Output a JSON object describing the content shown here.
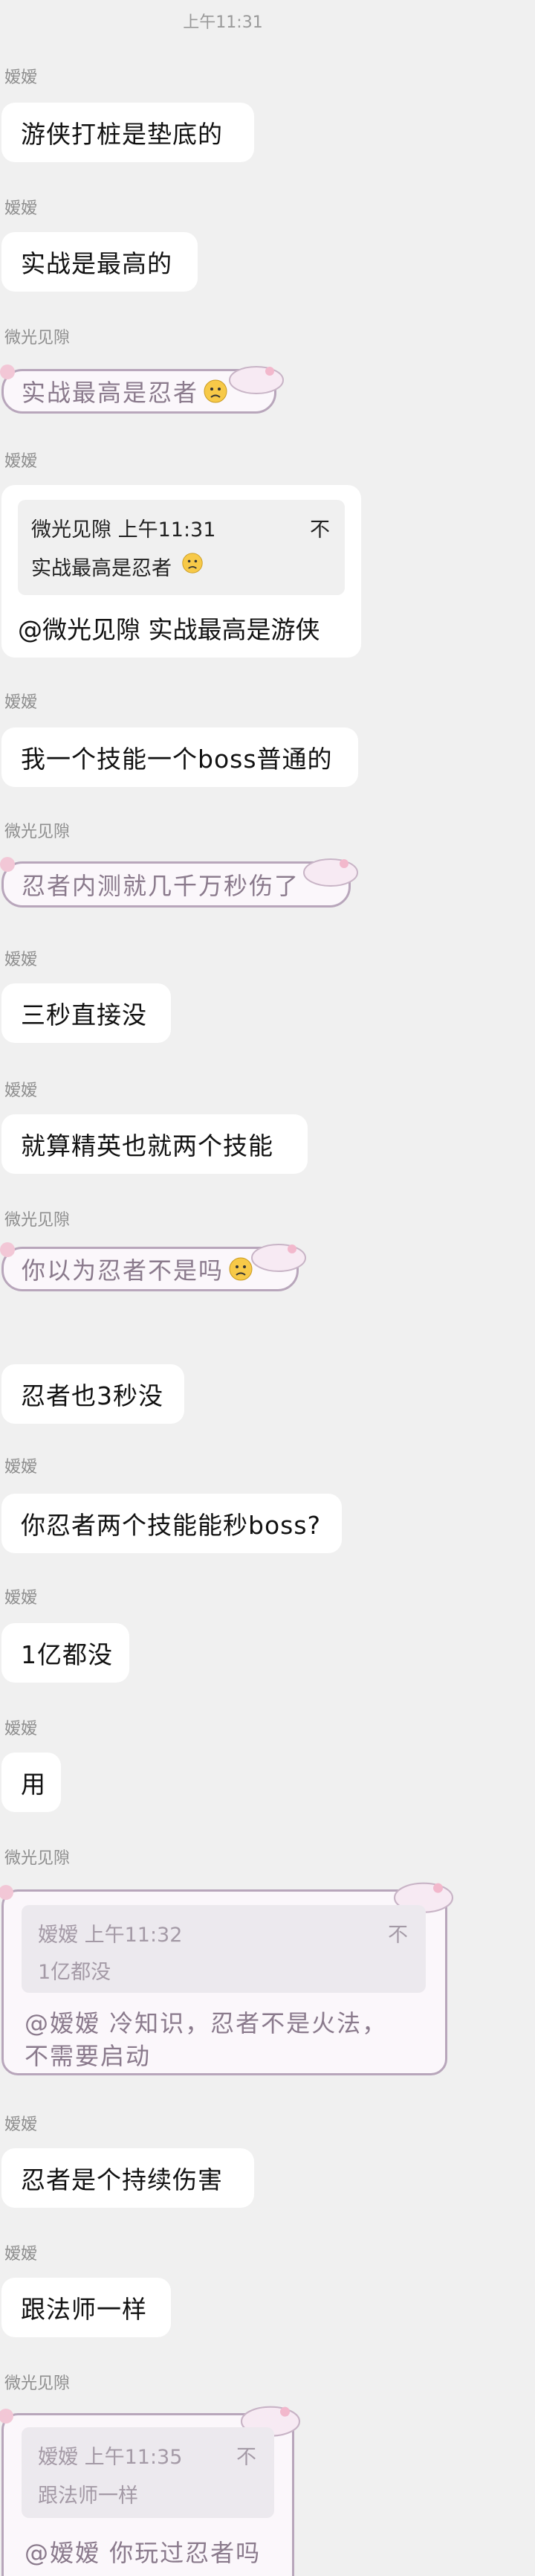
{
  "timestamp": "上午11:31",
  "messages": [
    {
      "sender": "嫒嫒",
      "text": "游侠打桩是垫底的"
    },
    {
      "sender": "嫒嫒",
      "text": "实战是最高的"
    },
    {
      "sender": "微光见隙",
      "text": "实战最高是忍者"
    },
    {
      "sender": "嫒嫒",
      "quote_header": "微光见隙 上午11:31",
      "quote_text": "实战最高是忍者",
      "text": "@微光见隙 实战最高是游侠"
    },
    {
      "sender": "嫒嫒",
      "text": "我一个技能一个boss普通的"
    },
    {
      "sender": "微光见隙",
      "text": "忍者内测就几千万秒伤了"
    },
    {
      "sender": "嫒嫒",
      "text": "三秒直接没"
    },
    {
      "sender": "嫒嫒",
      "text": "就算精英也就两个技能"
    },
    {
      "sender": "微光见隙",
      "text": "你以为忍者不是吗"
    },
    {
      "sender": "",
      "text": "忍者也3秒没"
    },
    {
      "sender": "嫒嫒",
      "text": "你忍者两个技能能秒boss?"
    },
    {
      "sender": "嫒嫒",
      "text": "1亿都没"
    },
    {
      "sender": "嫒嫒",
      "text": "用"
    },
    {
      "sender": "微光见隙",
      "quote_header": "嫒嫒 上午11:32",
      "quote_text": "1亿都没",
      "text": "@嫒嫒 冷知识，忍者不是火法，",
      "text2": "不需要启动"
    },
    {
      "sender": "嫒嫒",
      "text": "忍者是个持续伤害"
    },
    {
      "sender": "嫒嫒",
      "text": "跟法师一样"
    },
    {
      "sender": "微光见隙",
      "quote_header": "嫒嫒 上午11:35",
      "quote_text": "跟法师一样",
      "text": "@嫒嫒 你玩过忍者吗"
    }
  ],
  "icons": {
    "quote_close": "不",
    "emoji": "worried-face-emoji"
  },
  "colors": {
    "background": "#f0f0f0",
    "bubble": "#ffffff",
    "deco_border": "#b8a6bb",
    "deco_text": "#8a7a8c"
  }
}
